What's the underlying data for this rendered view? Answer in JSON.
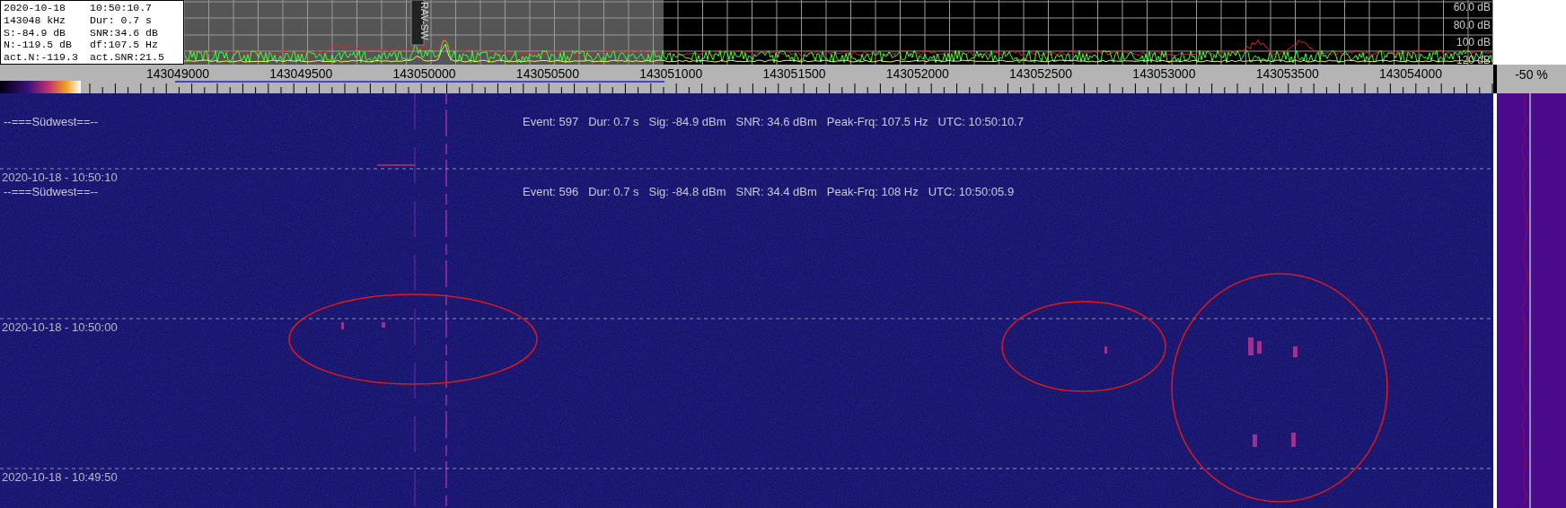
{
  "info_box": {
    "rows": [
      [
        "2020-10-18",
        "10:50:10.7"
      ],
      [
        "143048 kHz",
        "Dur: 0.7 s"
      ],
      [
        "S:-84.9 dB",
        "SNR:34.6 dB"
      ],
      [
        "N:-119.5 dB",
        "df:107.5 Hz"
      ],
      [
        "act.N:-119.3",
        "act.SNR:21.5"
      ]
    ]
  },
  "spectrum": {
    "marker_label": "RAV-SW",
    "db_labels": [
      "60.0 dB",
      "80.0 dB",
      "100 dB",
      "120 dB"
    ],
    "frequency_labels": [
      "143049000",
      "143049500",
      "143050000",
      "143050500",
      "143051000",
      "143051500",
      "143052000",
      "143052500",
      "143053000",
      "143053500",
      "143054000"
    ],
    "percent_label": "-50 %"
  },
  "waterfall": {
    "time_marks": [
      "2020-10-18 - 10:50:10",
      "2020-10-18 - 10:50:00",
      "2020-10-18 - 10:49:50"
    ],
    "events": [
      {
        "station": "--===Südwest==--",
        "fields": [
          "Event: 597",
          "Dur: 0.7 s",
          "Sig: -84.9 dBm",
          "SNR: 34.6 dBm",
          "Peak-Frq: 107.5 Hz",
          "UTC: 10:50:10.7"
        ]
      },
      {
        "station": "--===Südwest==--",
        "fields": [
          "Event: 596",
          "Dur: 0.7 s",
          "Sig: -84.8 dBm",
          "SNR: 34.4 dBm",
          "Peak-Frq: 108 Hz",
          "UTC: 10:50:05.9"
        ]
      }
    ]
  }
}
